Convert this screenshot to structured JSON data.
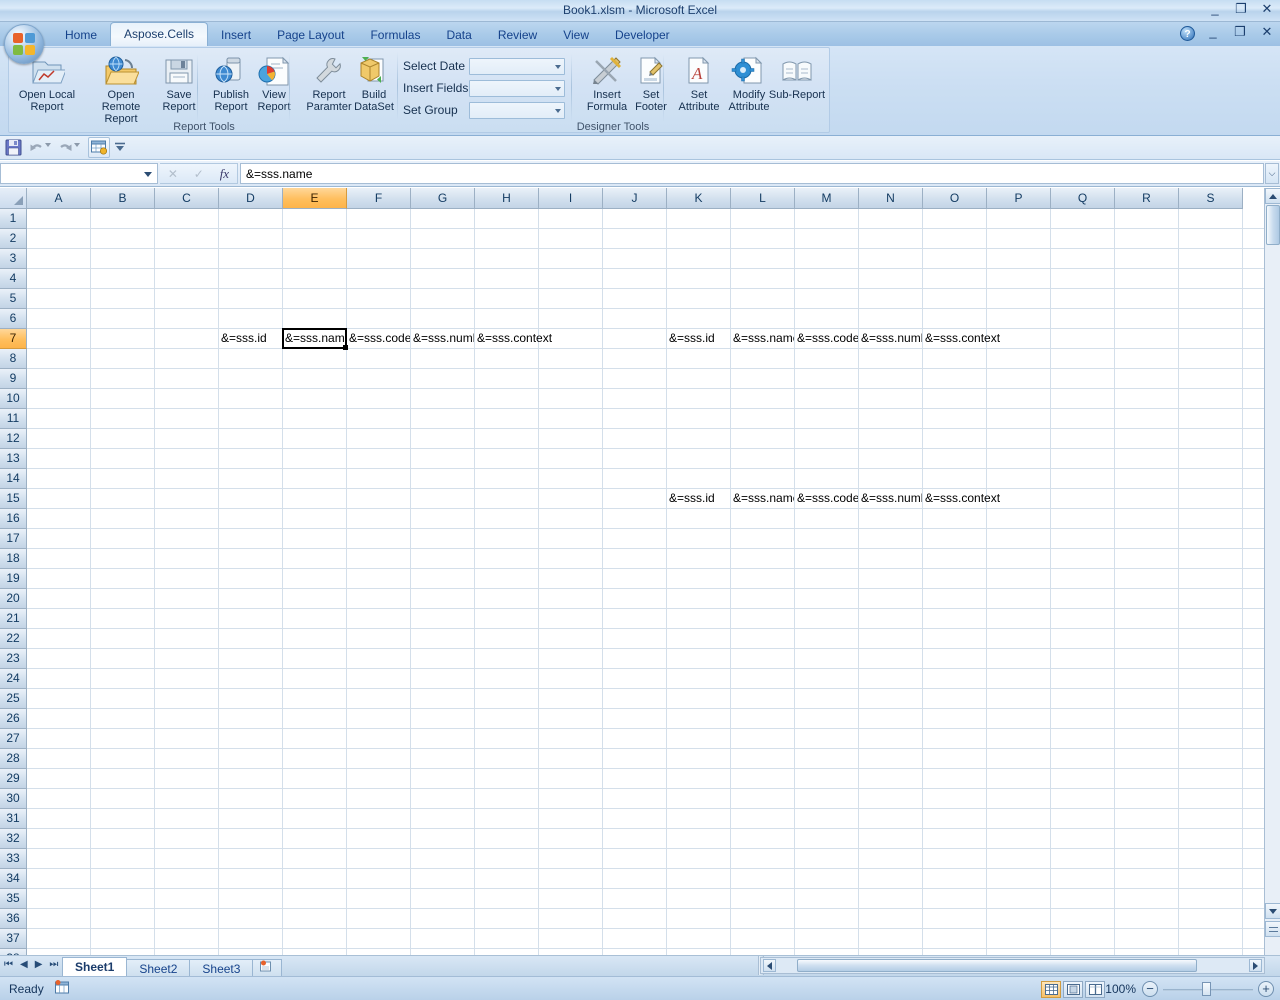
{
  "window": {
    "title": "Book1.xlsm - Microsoft Excel",
    "minimize": "_",
    "maximize": "❐",
    "close": "✕"
  },
  "ribbon_window": {
    "help": "?",
    "minimize": "_",
    "restore": "❐",
    "close": "✕"
  },
  "tabs": [
    {
      "label": "Home",
      "active": false
    },
    {
      "label": "Aspose.Cells",
      "active": true
    },
    {
      "label": "Insert",
      "active": false
    },
    {
      "label": "Page Layout",
      "active": false
    },
    {
      "label": "Formulas",
      "active": false
    },
    {
      "label": "Data",
      "active": false
    },
    {
      "label": "Review",
      "active": false
    },
    {
      "label": "View",
      "active": false
    },
    {
      "label": "Developer",
      "active": false
    }
  ],
  "ribbon": {
    "groups": [
      {
        "name": "Report Tools",
        "label": "Report Tools"
      },
      {
        "name": "Designer Tools",
        "label": "Designer Tools"
      }
    ],
    "report_tools": [
      {
        "icon": "open-local-report-icon",
        "line1": "Open Local",
        "line2": "Report"
      },
      {
        "icon": "open-remote-report-icon",
        "line1": "Open Remote",
        "line2": "Report"
      },
      {
        "icon": "save-report-icon",
        "line1": "Save",
        "line2": "Report"
      },
      {
        "icon": "publish-report-icon",
        "line1": "Publish",
        "line2": "Report"
      },
      {
        "icon": "view-report-icon",
        "line1": "View",
        "line2": "Report"
      },
      {
        "icon": "report-parameter-icon",
        "line1": "Report",
        "line2": "Paramter"
      },
      {
        "icon": "build-dataset-icon",
        "line1": "Build",
        "line2": "DataSet"
      }
    ],
    "designer_fields": [
      {
        "label": "Select Date",
        "value": ""
      },
      {
        "label": "Insert Fields",
        "value": ""
      },
      {
        "label": "Set Group",
        "value": ""
      }
    ],
    "designer_buttons": [
      {
        "icon": "insert-formula-icon",
        "line1": "Insert",
        "line2": "Formula"
      },
      {
        "icon": "set-footer-icon",
        "line1": "Set",
        "line2": "Footer"
      },
      {
        "icon": "set-attribute-icon",
        "line1": "Set",
        "line2": "Attribute"
      },
      {
        "icon": "modify-attribute-icon",
        "line1": "Modify",
        "line2": "Attribute"
      },
      {
        "icon": "sub-report-icon",
        "line1": "Sub-Report",
        "line2": ""
      }
    ]
  },
  "quick_access": {
    "items": [
      {
        "icon": "save-icon"
      },
      {
        "icon": "undo-icon"
      },
      {
        "icon": "undo-dropdown-icon"
      },
      {
        "icon": "redo-icon"
      },
      {
        "icon": "redo-dropdown-icon"
      },
      {
        "icon": "macro-icon"
      },
      {
        "icon": "customize-qat-icon"
      }
    ]
  },
  "formula_bar": {
    "name_box_value": "",
    "name_box_placeholder": "",
    "fx_label": "fx",
    "formula_value": "&=sss.name",
    "expand_glyph": "⌵"
  },
  "grid": {
    "columns": [
      "A",
      "B",
      "C",
      "D",
      "E",
      "F",
      "G",
      "H",
      "I",
      "J",
      "K",
      "L",
      "M",
      "N",
      "O",
      "P",
      "Q",
      "R",
      "S"
    ],
    "selected_column": "E",
    "selected_row": 7,
    "active_cell": "E7",
    "rows": [
      1,
      2,
      3,
      4,
      5,
      6,
      7,
      8,
      9,
      10,
      11,
      12,
      13,
      14,
      15,
      16,
      17,
      18,
      19,
      20,
      21,
      22,
      23,
      24,
      25,
      26,
      27,
      28,
      29,
      30,
      31,
      32,
      33,
      34,
      35,
      36,
      37,
      38
    ],
    "cells": [
      {
        "ref": "D7",
        "col": "D",
        "row": 7,
        "value": "&=sss.id",
        "clipped": false
      },
      {
        "ref": "E7",
        "col": "E",
        "row": 7,
        "value": "&=sss.name",
        "clipped": true
      },
      {
        "ref": "F7",
        "col": "F",
        "row": 7,
        "value": "&=sss.code",
        "clipped": true
      },
      {
        "ref": "G7",
        "col": "G",
        "row": 7,
        "value": "&=sss.number",
        "clipped": true
      },
      {
        "ref": "H7",
        "col": "H",
        "row": 7,
        "value": "&=sss.context",
        "clipped": false
      },
      {
        "ref": "K7",
        "col": "K",
        "row": 7,
        "value": "&=sss.id",
        "clipped": false
      },
      {
        "ref": "L7",
        "col": "L",
        "row": 7,
        "value": "&=sss.name",
        "clipped": true
      },
      {
        "ref": "M7",
        "col": "M",
        "row": 7,
        "value": "&=sss.code",
        "clipped": true
      },
      {
        "ref": "N7",
        "col": "N",
        "row": 7,
        "value": "&=sss.number",
        "clipped": true
      },
      {
        "ref": "O7",
        "col": "O",
        "row": 7,
        "value": "&=sss.context",
        "clipped": false
      },
      {
        "ref": "K15",
        "col": "K",
        "row": 15,
        "value": "&=sss.id",
        "clipped": false
      },
      {
        "ref": "L15",
        "col": "L",
        "row": 15,
        "value": "&=sss.name",
        "clipped": true
      },
      {
        "ref": "M15",
        "col": "M",
        "row": 15,
        "value": "&=sss.code",
        "clipped": true
      },
      {
        "ref": "N15",
        "col": "N",
        "row": 15,
        "value": "&=sss.number",
        "clipped": true
      },
      {
        "ref": "O15",
        "col": "O",
        "row": 15,
        "value": "&=sss.context",
        "clipped": false
      }
    ]
  },
  "sheet_tabs": {
    "nav": [
      "◀❙",
      "◀",
      "▶",
      "❙▶"
    ],
    "items": [
      {
        "label": "Sheet1",
        "active": true
      },
      {
        "label": "Sheet2",
        "active": false
      },
      {
        "label": "Sheet3",
        "active": false
      }
    ],
    "insert_tab_icon": "insert-sheet-icon"
  },
  "status_bar": {
    "state": "Ready",
    "macro_record_icon": "record-macro-icon",
    "view_buttons": [
      {
        "icon": "normal-view-icon",
        "active": true
      },
      {
        "icon": "page-layout-view-icon",
        "active": false
      },
      {
        "icon": "page-break-preview-icon",
        "active": false
      }
    ],
    "zoom_level": "100%",
    "zoom_out": "−",
    "zoom_in": "+"
  },
  "colors": {
    "accent_orange": "#ffbf5e",
    "header_blue": "#c3d4e6",
    "title_text": "#1c3f6e",
    "grid_line": "#d4dfea",
    "tab_text": "#15428b"
  }
}
